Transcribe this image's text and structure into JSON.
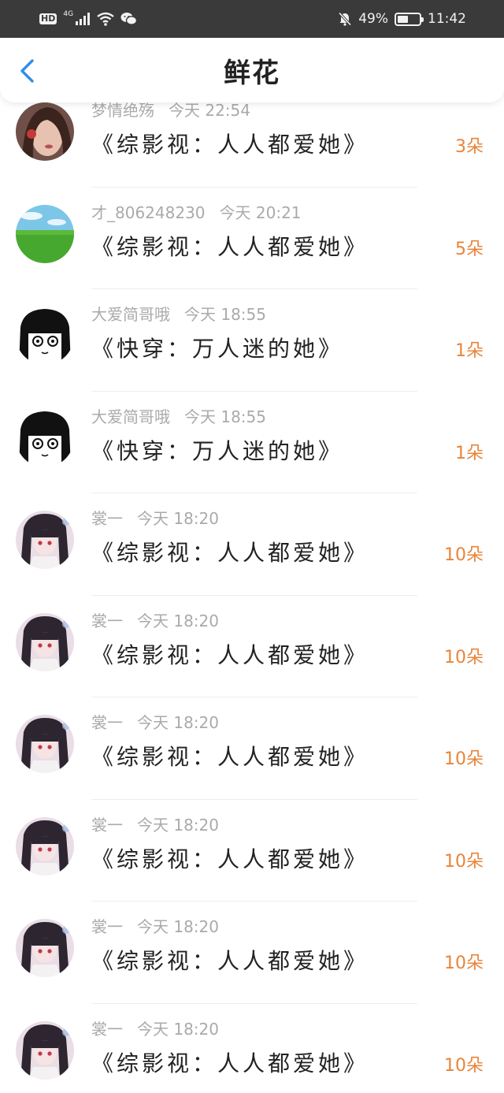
{
  "status_bar": {
    "hd": "HD",
    "network": "4G",
    "battery_percent": "49%",
    "battery_level": 0.49,
    "time": "11:42",
    "icons": [
      "signal-icon",
      "wifi-icon",
      "wechat-icon",
      "mute-bell-icon",
      "battery-icon"
    ]
  },
  "header": {
    "title": "鲜花",
    "back_icon": "chevron-left-icon",
    "accent_color": "#2f8fe8"
  },
  "amount_color": "#e8843a",
  "items": [
    {
      "user": "梦情绝殇",
      "time": "今天 22:54",
      "book": "《综影视：人人都爱她》",
      "amount": "3朵",
      "avatar": "girl-portrait"
    },
    {
      "user": "才_806248230",
      "time": "今天 20:21",
      "book": "《综影视：人人都爱她》",
      "amount": "5朵",
      "avatar": "grass-field"
    },
    {
      "user": "大爱简哥哦",
      "time": "今天 18:55",
      "book": "《快穿：万人迷的她》",
      "amount": "1朵",
      "avatar": "manga-girl"
    },
    {
      "user": "大爱简哥哦",
      "time": "今天 18:55",
      "book": "《快穿：万人迷的她》",
      "amount": "1朵",
      "avatar": "manga-girl"
    },
    {
      "user": "裳一",
      "time": "今天 18:20",
      "book": "《综影视：人人都爱她》",
      "amount": "10朵",
      "avatar": "anime-girl"
    },
    {
      "user": "裳一",
      "time": "今天 18:20",
      "book": "《综影视：人人都爱她》",
      "amount": "10朵",
      "avatar": "anime-girl"
    },
    {
      "user": "裳一",
      "time": "今天 18:20",
      "book": "《综影视：人人都爱她》",
      "amount": "10朵",
      "avatar": "anime-girl"
    },
    {
      "user": "裳一",
      "time": "今天 18:20",
      "book": "《综影视：人人都爱她》",
      "amount": "10朵",
      "avatar": "anime-girl"
    },
    {
      "user": "裳一",
      "time": "今天 18:20",
      "book": "《综影视：人人都爱她》",
      "amount": "10朵",
      "avatar": "anime-girl"
    },
    {
      "user": "裳一",
      "time": "今天 18:20",
      "book": "《综影视：人人都爱她》",
      "amount": "10朵",
      "avatar": "anime-girl"
    }
  ]
}
